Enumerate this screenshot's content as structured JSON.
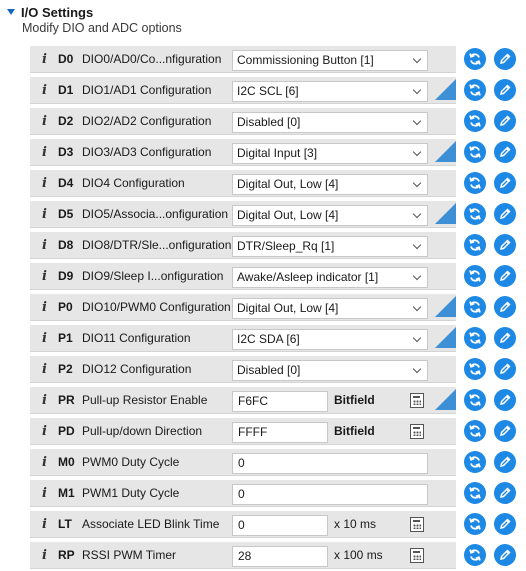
{
  "section": {
    "title": "I/O Settings",
    "subtitle": "Modify DIO and ADC options"
  },
  "colors": {
    "accent": "#1e88e5",
    "changed_marker": "#3d8fd6",
    "panel": "#e6e6e6"
  },
  "icons": {
    "info": "info-icon",
    "read": "read-refresh-icon",
    "write": "write-pencil-icon",
    "calculator": "calculator-icon",
    "expand": "chevron-down-icon"
  },
  "rows": [
    {
      "code": "D0",
      "label": "DIO0/AD0/Co...nfiguration",
      "type": "select",
      "value": "Commissioning Button [1]",
      "changed": false
    },
    {
      "code": "D1",
      "label": "DIO1/AD1 Configuration",
      "type": "select",
      "value": "I2C SCL [6]",
      "changed": true
    },
    {
      "code": "D2",
      "label": "DIO2/AD2 Configuration",
      "type": "select",
      "value": "Disabled [0]",
      "changed": false
    },
    {
      "code": "D3",
      "label": "DIO3/AD3 Configuration",
      "type": "select",
      "value": "Digital Input [3]",
      "changed": true
    },
    {
      "code": "D4",
      "label": "DIO4 Configuration",
      "type": "select",
      "value": "Digital Out, Low [4]",
      "changed": false
    },
    {
      "code": "D5",
      "label": "DIO5/Associa...onfiguration",
      "type": "select",
      "value": "Digital Out, Low [4]",
      "changed": true
    },
    {
      "code": "D8",
      "label": "DIO8/DTR/Sle...onfiguration",
      "type": "select",
      "value": "DTR/Sleep_Rq [1]",
      "changed": false
    },
    {
      "code": "D9",
      "label": "DIO9/Sleep I...onfiguration",
      "type": "select",
      "value": "Awake/Asleep indicator [1]",
      "changed": false
    },
    {
      "code": "P0",
      "label": "DIO10/PWM0 Configuration",
      "type": "select",
      "value": "Digital Out, Low [4]",
      "changed": true
    },
    {
      "code": "P1",
      "label": "DIO11 Configuration",
      "type": "select",
      "value": "I2C SDA [6]",
      "changed": true
    },
    {
      "code": "P2",
      "label": "DIO12 Configuration",
      "type": "select",
      "value": "Disabled [0]",
      "changed": false
    },
    {
      "code": "PR",
      "label": "Pull-up Resistor Enable",
      "type": "text-unit",
      "value": "F6FC",
      "unit": "Bitfield",
      "changed": true
    },
    {
      "code": "PD",
      "label": "Pull-up/down Direction",
      "type": "text-unit",
      "value": "FFFF",
      "unit": "Bitfield",
      "changed": false
    },
    {
      "code": "M0",
      "label": "PWM0 Duty Cycle",
      "type": "text",
      "value": "0",
      "changed": false
    },
    {
      "code": "M1",
      "label": "PWM1 Duty Cycle",
      "type": "text",
      "value": "0",
      "changed": false
    },
    {
      "code": "LT",
      "label": "Associate LED Blink Time",
      "type": "text-unit",
      "value": "0",
      "unit": "x 10 ms",
      "changed": false
    },
    {
      "code": "RP",
      "label": "RSSI PWM Timer",
      "type": "text-unit",
      "value": "28",
      "unit": "x 100 ms",
      "changed": false
    }
  ]
}
